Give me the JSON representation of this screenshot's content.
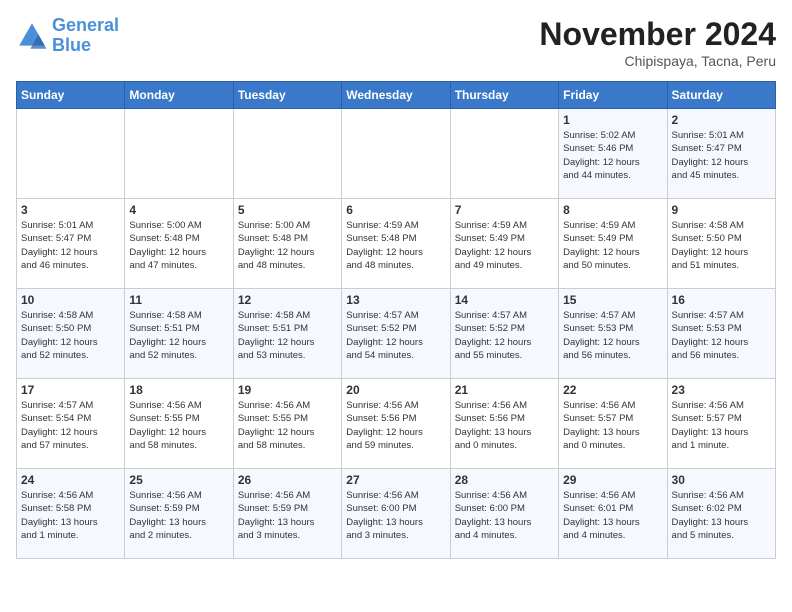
{
  "logo": {
    "line1": "General",
    "line2": "Blue"
  },
  "title": "November 2024",
  "subtitle": "Chipispaya, Tacna, Peru",
  "days_of_week": [
    "Sunday",
    "Monday",
    "Tuesday",
    "Wednesday",
    "Thursday",
    "Friday",
    "Saturday"
  ],
  "weeks": [
    [
      {
        "day": "",
        "info": ""
      },
      {
        "day": "",
        "info": ""
      },
      {
        "day": "",
        "info": ""
      },
      {
        "day": "",
        "info": ""
      },
      {
        "day": "",
        "info": ""
      },
      {
        "day": "1",
        "info": "Sunrise: 5:02 AM\nSunset: 5:46 PM\nDaylight: 12 hours\nand 44 minutes."
      },
      {
        "day": "2",
        "info": "Sunrise: 5:01 AM\nSunset: 5:47 PM\nDaylight: 12 hours\nand 45 minutes."
      }
    ],
    [
      {
        "day": "3",
        "info": "Sunrise: 5:01 AM\nSunset: 5:47 PM\nDaylight: 12 hours\nand 46 minutes."
      },
      {
        "day": "4",
        "info": "Sunrise: 5:00 AM\nSunset: 5:48 PM\nDaylight: 12 hours\nand 47 minutes."
      },
      {
        "day": "5",
        "info": "Sunrise: 5:00 AM\nSunset: 5:48 PM\nDaylight: 12 hours\nand 48 minutes."
      },
      {
        "day": "6",
        "info": "Sunrise: 4:59 AM\nSunset: 5:48 PM\nDaylight: 12 hours\nand 48 minutes."
      },
      {
        "day": "7",
        "info": "Sunrise: 4:59 AM\nSunset: 5:49 PM\nDaylight: 12 hours\nand 49 minutes."
      },
      {
        "day": "8",
        "info": "Sunrise: 4:59 AM\nSunset: 5:49 PM\nDaylight: 12 hours\nand 50 minutes."
      },
      {
        "day": "9",
        "info": "Sunrise: 4:58 AM\nSunset: 5:50 PM\nDaylight: 12 hours\nand 51 minutes."
      }
    ],
    [
      {
        "day": "10",
        "info": "Sunrise: 4:58 AM\nSunset: 5:50 PM\nDaylight: 12 hours\nand 52 minutes."
      },
      {
        "day": "11",
        "info": "Sunrise: 4:58 AM\nSunset: 5:51 PM\nDaylight: 12 hours\nand 52 minutes."
      },
      {
        "day": "12",
        "info": "Sunrise: 4:58 AM\nSunset: 5:51 PM\nDaylight: 12 hours\nand 53 minutes."
      },
      {
        "day": "13",
        "info": "Sunrise: 4:57 AM\nSunset: 5:52 PM\nDaylight: 12 hours\nand 54 minutes."
      },
      {
        "day": "14",
        "info": "Sunrise: 4:57 AM\nSunset: 5:52 PM\nDaylight: 12 hours\nand 55 minutes."
      },
      {
        "day": "15",
        "info": "Sunrise: 4:57 AM\nSunset: 5:53 PM\nDaylight: 12 hours\nand 56 minutes."
      },
      {
        "day": "16",
        "info": "Sunrise: 4:57 AM\nSunset: 5:53 PM\nDaylight: 12 hours\nand 56 minutes."
      }
    ],
    [
      {
        "day": "17",
        "info": "Sunrise: 4:57 AM\nSunset: 5:54 PM\nDaylight: 12 hours\nand 57 minutes."
      },
      {
        "day": "18",
        "info": "Sunrise: 4:56 AM\nSunset: 5:55 PM\nDaylight: 12 hours\nand 58 minutes."
      },
      {
        "day": "19",
        "info": "Sunrise: 4:56 AM\nSunset: 5:55 PM\nDaylight: 12 hours\nand 58 minutes."
      },
      {
        "day": "20",
        "info": "Sunrise: 4:56 AM\nSunset: 5:56 PM\nDaylight: 12 hours\nand 59 minutes."
      },
      {
        "day": "21",
        "info": "Sunrise: 4:56 AM\nSunset: 5:56 PM\nDaylight: 13 hours\nand 0 minutes."
      },
      {
        "day": "22",
        "info": "Sunrise: 4:56 AM\nSunset: 5:57 PM\nDaylight: 13 hours\nand 0 minutes."
      },
      {
        "day": "23",
        "info": "Sunrise: 4:56 AM\nSunset: 5:57 PM\nDaylight: 13 hours\nand 1 minute."
      }
    ],
    [
      {
        "day": "24",
        "info": "Sunrise: 4:56 AM\nSunset: 5:58 PM\nDaylight: 13 hours\nand 1 minute."
      },
      {
        "day": "25",
        "info": "Sunrise: 4:56 AM\nSunset: 5:59 PM\nDaylight: 13 hours\nand 2 minutes."
      },
      {
        "day": "26",
        "info": "Sunrise: 4:56 AM\nSunset: 5:59 PM\nDaylight: 13 hours\nand 3 minutes."
      },
      {
        "day": "27",
        "info": "Sunrise: 4:56 AM\nSunset: 6:00 PM\nDaylight: 13 hours\nand 3 minutes."
      },
      {
        "day": "28",
        "info": "Sunrise: 4:56 AM\nSunset: 6:00 PM\nDaylight: 13 hours\nand 4 minutes."
      },
      {
        "day": "29",
        "info": "Sunrise: 4:56 AM\nSunset: 6:01 PM\nDaylight: 13 hours\nand 4 minutes."
      },
      {
        "day": "30",
        "info": "Sunrise: 4:56 AM\nSunset: 6:02 PM\nDaylight: 13 hours\nand 5 minutes."
      }
    ]
  ]
}
